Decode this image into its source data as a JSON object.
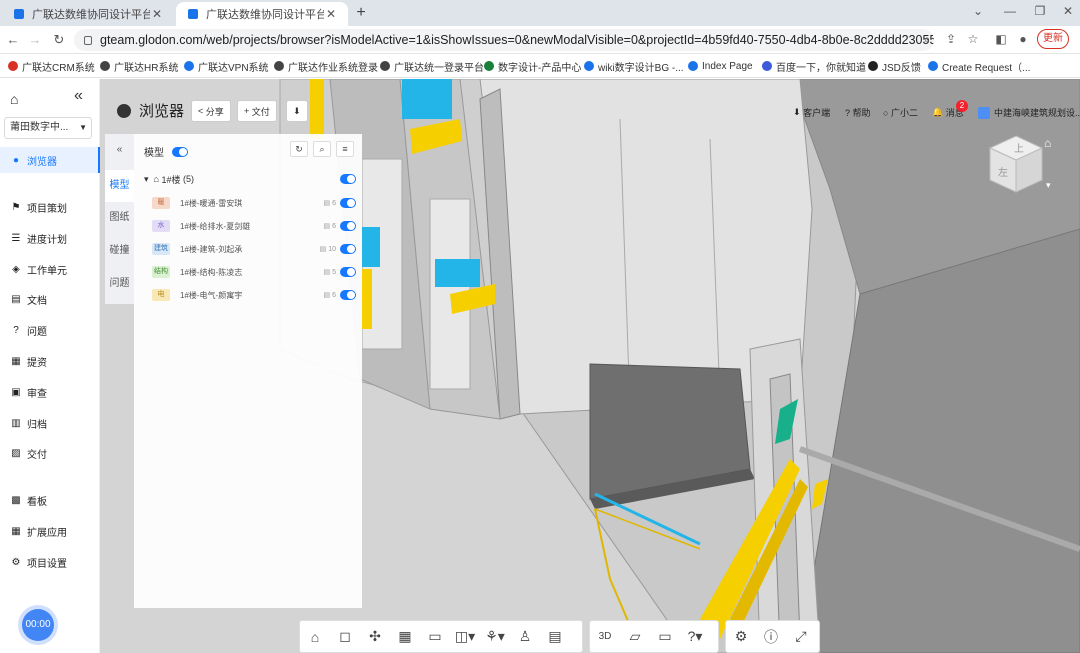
{
  "browser": {
    "tabs": [
      {
        "title": "广联达数维协同设计平台",
        "active": false
      },
      {
        "title": "广联达数维协同设计平台",
        "active": true
      }
    ],
    "new_tab": "+",
    "window_controls": [
      "⌄",
      "—",
      "❐",
      "✕"
    ],
    "url": "gteam.glodon.com/web/projects/browser?isModelActive=1&isShowIssues=0&newModalVisible=0&projectId=4b59fd40-7550-4db4-8b0e-8c2dddd23055&showDetail=0",
    "update_label": "更新",
    "bookmarks": [
      {
        "label": "广联达CRM系统",
        "color": "#d93025"
      },
      {
        "label": "广联达HR系统",
        "color": "#444444"
      },
      {
        "label": "广联达VPN系统",
        "color": "#1a73e8"
      },
      {
        "label": "广联达作业系统登录",
        "color": "#444444"
      },
      {
        "label": "广联达统一登录平台",
        "color": "#444444"
      },
      {
        "label": "数字设计-产品中心",
        "color": "#188038"
      },
      {
        "label": "wiki数字设计BG -...",
        "color": "#1a73e8"
      },
      {
        "label": "Index Page",
        "color": "#1a73e8"
      },
      {
        "label": "百度一下，你就知道",
        "color": "#3b5bdb"
      },
      {
        "label": "JSD反馈",
        "color": "#222222"
      },
      {
        "label": "Create Request（...",
        "color": "#1a73e8"
      }
    ]
  },
  "app": {
    "project": "莆田数字中...",
    "nav": [
      {
        "label": "浏览器",
        "icon": "●",
        "active": true
      },
      {
        "label": "项目策划",
        "icon": "⚑",
        "active": false
      },
      {
        "label": "进度计划",
        "icon": "☰",
        "active": false
      },
      {
        "label": "工作单元",
        "icon": "◈",
        "active": false
      },
      {
        "label": "文档",
        "icon": "▤",
        "active": false
      },
      {
        "label": "问题",
        "icon": "?",
        "active": false
      },
      {
        "label": "提资",
        "icon": "▦",
        "active": false
      },
      {
        "label": "审查",
        "icon": "▣",
        "active": false
      },
      {
        "label": "归档",
        "icon": "▥",
        "active": false
      },
      {
        "label": "交付",
        "icon": "▨",
        "active": false
      },
      {
        "label": "看板",
        "icon": "▩",
        "active": false
      },
      {
        "label": "扩展应用",
        "icon": "▦",
        "active": false
      },
      {
        "label": "项目设置",
        "icon": "⚙",
        "active": false
      }
    ],
    "timer": "00:00"
  },
  "viewer": {
    "title": "浏览器",
    "share_label": "分享",
    "deliver_label": "文付",
    "right_tools": [
      {
        "label": "客户端",
        "icon": "⬇"
      },
      {
        "label": "帮助",
        "icon": "?"
      },
      {
        "label": "广小二",
        "icon": "○"
      },
      {
        "label": "消息",
        "icon": "🔔"
      }
    ],
    "message_count": "2",
    "user": "中建海峡建筑规划设...",
    "side_tabs": [
      "«",
      "模型",
      "图纸",
      "碰撞",
      "问题"
    ],
    "panel": {
      "header": "模型",
      "root": {
        "label": "1#楼",
        "count": "(5)"
      },
      "models": [
        {
          "tag": "暖",
          "tag_color": "#f7d9c9",
          "tag_text": "#c26a3e",
          "name": "1#楼-暖通-雷安琪",
          "count": "6"
        },
        {
          "tag": "水",
          "tag_color": "#e3dcf7",
          "tag_text": "#7a61c7",
          "name": "1#楼-给排水-夏剑雄",
          "count": "6"
        },
        {
          "tag": "建筑",
          "tag_color": "#d7e7f7",
          "tag_text": "#3d78b8",
          "name": "1#楼-建筑-刘起承",
          "count": "10"
        },
        {
          "tag": "结构",
          "tag_color": "#d9f0d2",
          "tag_text": "#4a8f3a",
          "name": "1#楼-结构-陈凌志",
          "count": "5"
        },
        {
          "tag": "电",
          "tag_color": "#f9e7b6",
          "tag_text": "#b58a14",
          "name": "1#楼-电气-颜寓宇",
          "count": "6"
        }
      ]
    },
    "bottom_tools": [
      "⌂",
      "◻",
      "✣",
      "▦",
      "▭",
      "◫▾",
      "⚘▾",
      "♙",
      "▤",
      "3D",
      "▱",
      "▭",
      "?▾",
      "⚙",
      "ⓘ",
      "⤢"
    ],
    "cube": {
      "top": "上",
      "front": "左"
    }
  }
}
